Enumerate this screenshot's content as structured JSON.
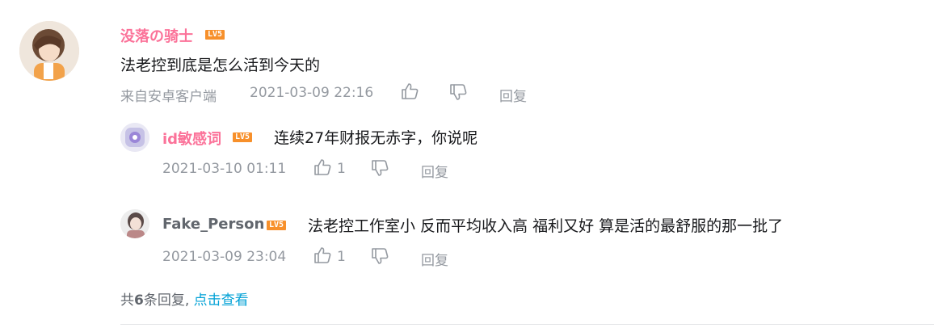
{
  "main_comment": {
    "username": "没落の骑士",
    "level": "LV5",
    "text": "法老控到底是怎么活到今天的",
    "source": "来自安卓客户端",
    "time": "2021-03-09 22:16",
    "reply_label": "回复"
  },
  "replies": [
    {
      "username": "id敏感词",
      "level": "LV5",
      "text": "连续27年财报无赤字，你说呢",
      "time": "2021-03-10 01:11",
      "likes": "1",
      "reply_label": "回复"
    },
    {
      "username": "Fake_Person",
      "level": "LV5",
      "text": "法老控工作室小 反而平均收入高 福利又好 算是活的最舒服的那一批了",
      "time": "2021-03-09 23:04",
      "likes": "1",
      "reply_label": "回复"
    }
  ],
  "more_replies": {
    "prefix": "共",
    "count": "6",
    "suffix": "条回复,",
    "link": "点击查看"
  },
  "colors": {
    "username": "#fb7299",
    "level_badge": "#f7902b",
    "link": "#00a1d6",
    "meta": "#9499a0"
  }
}
